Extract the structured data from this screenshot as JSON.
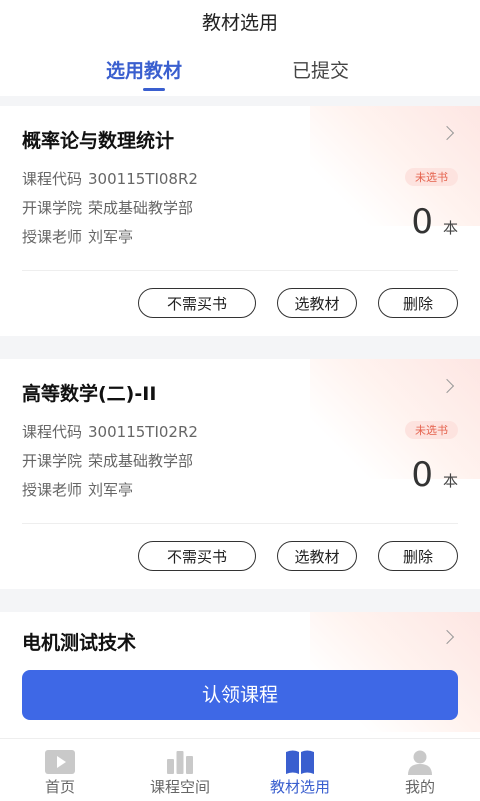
{
  "header": {
    "title": "教材选用",
    "tabs": [
      {
        "label": "选用教材",
        "active": true
      },
      {
        "label": "已提交",
        "active": false
      }
    ]
  },
  "courses": [
    {
      "name": "概率论与数理统计",
      "code_label": "课程代码",
      "code": "300115TI08R2",
      "college_label": "开课学院",
      "college": "荣成基础教学部",
      "teacher_label": "授课老师",
      "teacher": "刘军亭",
      "status": "未选书",
      "count": "0",
      "unit": "本",
      "buttons": {
        "no_buy": "不需买书",
        "select": "选教材",
        "delete": "删除"
      }
    },
    {
      "name": "高等数学(二)-II",
      "code_label": "课程代码",
      "code": "300115TI02R2",
      "college_label": "开课学院",
      "college": "荣成基础教学部",
      "teacher_label": "授课老师",
      "teacher": "刘军亭",
      "status": "未选书",
      "count": "0",
      "unit": "本",
      "buttons": {
        "no_buy": "不需买书",
        "select": "选教材",
        "delete": "删除"
      }
    },
    {
      "name": "电机测试技术"
    }
  ],
  "claim_button": "认领课程",
  "tabbar": [
    {
      "label": "首页",
      "icon": "play-icon",
      "active": false
    },
    {
      "label": "课程空间",
      "icon": "bar-chart-icon",
      "active": false
    },
    {
      "label": "教材选用",
      "icon": "book-icon",
      "active": true
    },
    {
      "label": "我的",
      "icon": "person-icon",
      "active": false
    }
  ],
  "colors": {
    "accent": "#3a5fcf",
    "primary_button": "#3e68e6",
    "badge_bg": "#fde3df",
    "badge_text": "#e5624d"
  }
}
